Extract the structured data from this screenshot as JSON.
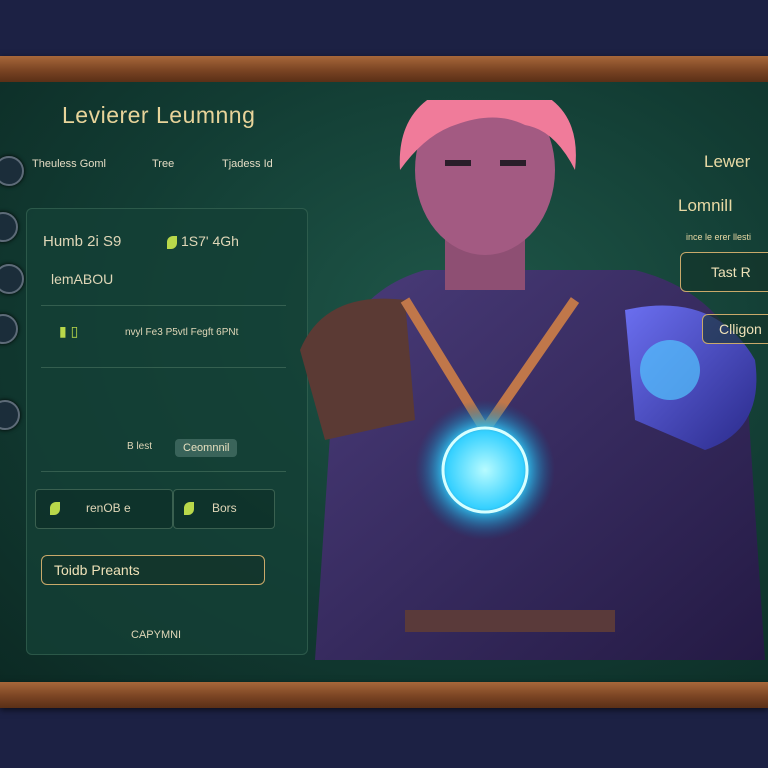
{
  "window": {
    "title": "Levierer Leumnng"
  },
  "side_menu": [
    {
      "icon": "coin-icon",
      "label": ""
    },
    {
      "icon": "shield-icon",
      "label": ""
    },
    {
      "icon": "helmet-icon",
      "label": ""
    },
    {
      "icon": "scroll-icon",
      "label": ""
    },
    {
      "icon": "gem-icon",
      "label": ""
    }
  ],
  "tabs": [
    "Theuless Goml",
    "Tree",
    "Tjadess Id"
  ],
  "panel": {
    "stat_line": "Humb 2i S9",
    "stat_value": "1S7' 4Gh",
    "subheading": "lemABOU",
    "info_line": "nvyl Fe3 P5vtl Fegft 6PNt",
    "option_label": "B lest",
    "option_pill": "Ceomnnil",
    "stat_a_label": "renOB e",
    "stat_b_label": "Bors",
    "primary_button": "Toidb Preants",
    "footer": "CAPYMNI"
  },
  "right_panel": {
    "heading": "Lewer",
    "subheading": "LomnilI",
    "small_text": "ince le erer llesti",
    "button_1": "Tast R",
    "button_2": "Clligon"
  },
  "colors": {
    "accent": "#c9a96a",
    "board": "#123c33",
    "frame_wood": "#7a4423",
    "core_glow": "#34d0ff"
  }
}
